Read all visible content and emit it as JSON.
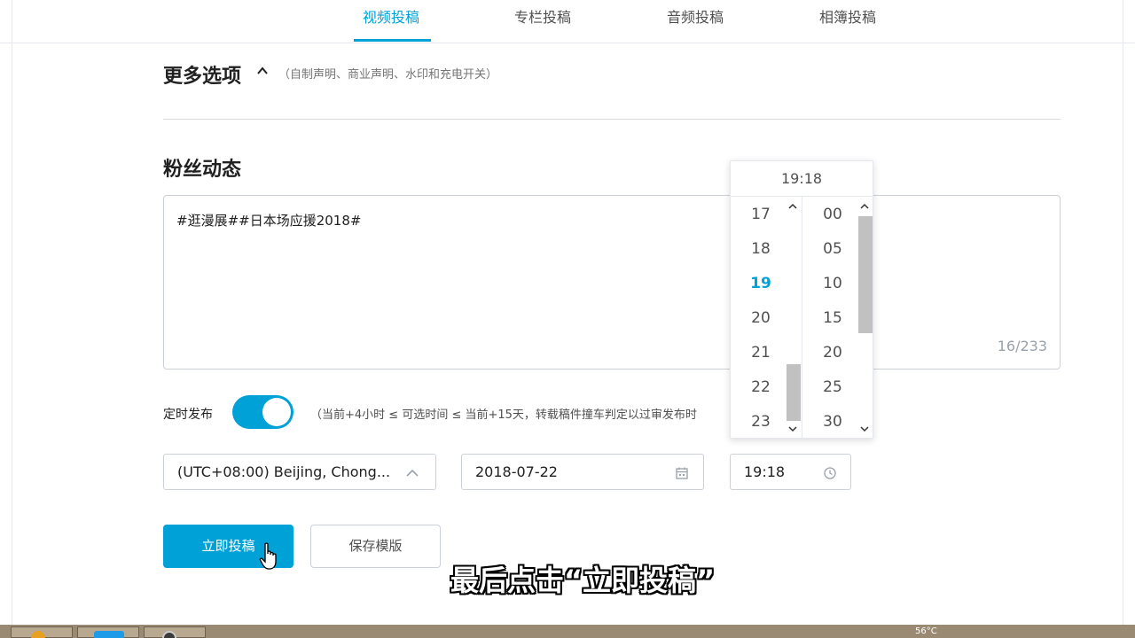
{
  "tabs": [
    {
      "label": "视频投稿",
      "active": true
    },
    {
      "label": "专栏投稿",
      "active": false
    },
    {
      "label": "音频投稿",
      "active": false
    },
    {
      "label": "相簿投稿",
      "active": false
    }
  ],
  "more_options": {
    "title": "更多选项",
    "hint": "（自制声明、商业声明、水印和充电开关）"
  },
  "fan_dynamics": {
    "title": "粉丝动态",
    "text": "#逛漫展##日本场应援2018#",
    "count": "16/233"
  },
  "schedule": {
    "label": "定时发布",
    "enabled": true,
    "hint": "（当前+4小时 ≤ 可选时间 ≤ 当前+15天，转载稿件撞车判定以过审发布时"
  },
  "timezone": {
    "value": "(UTC+08:00) Beijing, Chong..."
  },
  "date": {
    "value": "2018-07-22"
  },
  "time": {
    "value": "19:18"
  },
  "picker": {
    "header": "19:18",
    "hours": [
      "17",
      "18",
      "19",
      "20",
      "21",
      "22",
      "23"
    ],
    "minutes": [
      "00",
      "05",
      "10",
      "15",
      "20",
      "25",
      "30"
    ],
    "selected_hour": "19"
  },
  "buttons": {
    "submit": "立即投稿",
    "save_template": "保存模版"
  },
  "subtitle": "最后点击“立即投稿”",
  "taskbar": {
    "tray_text": "56°C"
  },
  "colors": {
    "accent": "#00a1d6",
    "border": "#ccd0d7"
  }
}
